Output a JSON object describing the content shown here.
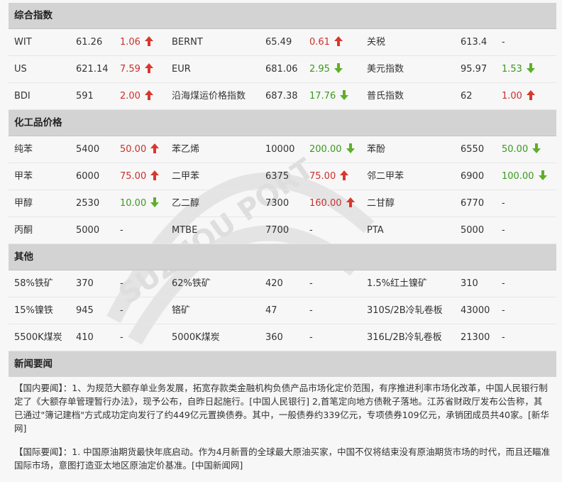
{
  "sections": [
    {
      "title": "综合指数",
      "rows": [
        [
          {
            "name": "WIT",
            "price": "61.26",
            "change": "1.06",
            "dir": "up"
          },
          {
            "name": "BERNT",
            "price": "65.49",
            "change": "0.61",
            "dir": "up"
          },
          {
            "name": "关税",
            "price": "613.4",
            "change": "-",
            "dir": "none"
          }
        ],
        [
          {
            "name": "US",
            "price": "621.14",
            "change": "7.59",
            "dir": "up"
          },
          {
            "name": "EUR",
            "price": "681.06",
            "change": "2.95",
            "dir": "down"
          },
          {
            "name": "美元指数",
            "price": "95.97",
            "change": "1.53",
            "dir": "down"
          }
        ],
        [
          {
            "name": "BDI",
            "price": "591",
            "change": "2.00",
            "dir": "up"
          },
          {
            "name": "沿海煤运价格指数",
            "price": "687.38",
            "change": "17.76",
            "dir": "down"
          },
          {
            "name": "普氏指数",
            "price": "62",
            "change": "1.00",
            "dir": "up"
          }
        ]
      ]
    },
    {
      "title": "化工品价格",
      "rows": [
        [
          {
            "name": "纯苯",
            "price": "5400",
            "change": "50.00",
            "dir": "up"
          },
          {
            "name": "苯乙烯",
            "price": "10000",
            "change": "200.00",
            "dir": "down"
          },
          {
            "name": "苯酚",
            "price": "6550",
            "change": "50.00",
            "dir": "down"
          }
        ],
        [
          {
            "name": "甲苯",
            "price": "6000",
            "change": "75.00",
            "dir": "up"
          },
          {
            "name": "二甲苯",
            "price": "6375",
            "change": "75.00",
            "dir": "up"
          },
          {
            "name": "邻二甲苯",
            "price": "6900",
            "change": "100.00",
            "dir": "down"
          }
        ],
        [
          {
            "name": "甲醇",
            "price": "2530",
            "change": "10.00",
            "dir": "down"
          },
          {
            "name": "乙二醇",
            "price": "7300",
            "change": "160.00",
            "dir": "up"
          },
          {
            "name": "二甘醇",
            "price": "6770",
            "change": "-",
            "dir": "none"
          }
        ],
        [
          {
            "name": "丙酮",
            "price": "5000",
            "change": "-",
            "dir": "none"
          },
          {
            "name": "MTBE",
            "price": "7700",
            "change": "-",
            "dir": "none"
          },
          {
            "name": "PTA",
            "price": "5000",
            "change": "-",
            "dir": "none"
          }
        ]
      ]
    },
    {
      "title": "其他",
      "rows": [
        [
          {
            "name": "58%铁矿",
            "price": "370",
            "change": "-",
            "dir": "none"
          },
          {
            "name": "62%铁矿",
            "price": "420",
            "change": "-",
            "dir": "none"
          },
          {
            "name": "1.5%红土镍矿",
            "price": "310",
            "change": "-",
            "dir": "none"
          }
        ],
        [
          {
            "name": "15%镍铁",
            "price": "945",
            "change": "-",
            "dir": "none"
          },
          {
            "name": "铬矿",
            "price": "47",
            "change": "-",
            "dir": "none"
          },
          {
            "name": "310S/2B冷轧卷板",
            "price": "43000",
            "change": "-",
            "dir": "none"
          }
        ],
        [
          {
            "name": "5500K煤炭",
            "price": "410",
            "change": "-",
            "dir": "none"
          },
          {
            "name": "5000K煤炭",
            "price": "360",
            "change": "-",
            "dir": "none"
          },
          {
            "name": "316L/2B冷轧卷板",
            "price": "21300",
            "change": "-",
            "dir": "none"
          }
        ]
      ]
    }
  ],
  "news": {
    "title": "新闻要闻",
    "domestic": "【国内要闻】：1、为规范大额存单业务发展，拓宽存款类金融机构负债产品市场化定价范围，有序推进利率市场化改革，中国人民银行制定了《大额存单管理暂行办法》，现予公布，自昨日起施行。[中国人民银行] 2,首笔定向地方债靴子落地。江苏省财政厅发布公告称，其已通过\"簿记建档\"方式成功定向发行了约449亿元置换债券。其中，一般债券约339亿元，专项债券109亿元，承销团成员共40家。[新华网]",
    "international": "【国际要闻】：1. 中国原油期货最快年底启动。作为4月新晋的全球最大原油买家，中国不仅将结束没有原油期货市场的时代，而且还瞄准国际市场，意图打造亚太地区原油定价基准。[中国新闻网]"
  },
  "watermark": {
    "text": "SUZHOU PORT",
    "color": "#e0e0e0"
  },
  "colors": {
    "up": "#c9302c",
    "down": "#3a9a1c",
    "header_bg": "#d3d3d3"
  }
}
